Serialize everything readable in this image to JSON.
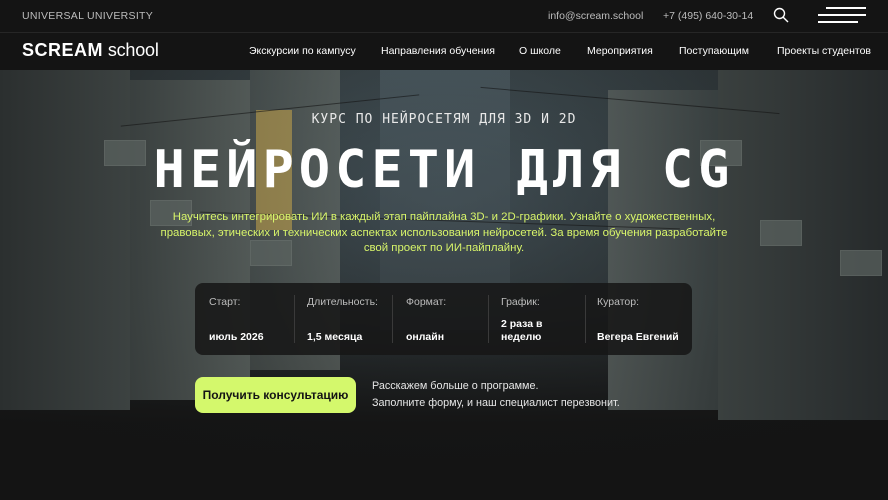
{
  "topbar": {
    "brand": "UNIVERSAL UNIVERSITY",
    "email": "info@scream.school",
    "phone": "+7 (495) 640-30-14"
  },
  "nav": {
    "logo_bold": "SCREAM",
    "logo_light": "school",
    "items": [
      {
        "label": "Экскурсии по кампусу"
      },
      {
        "label": "Направления обучения"
      },
      {
        "label": "О школе"
      },
      {
        "label": "Мероприятия"
      },
      {
        "label": "Поступающим"
      },
      {
        "label": "Проекты студентов"
      }
    ]
  },
  "hero": {
    "subtitle": "КУРС ПО НЕЙРОСЕТЯМ ДЛЯ 3D И 2D",
    "title": "НЕЙРОСЕТИ ДЛЯ CG",
    "description": "Научитесь интегрировать ИИ в каждый этап пайплайна 3D- и 2D-графики. Узнайте о художественных, правовых, этических и технических аспектах использования нейросетей. За время обучения разработайте свой проект по ИИ-пайплайну.",
    "info": [
      {
        "label": "Старт:",
        "value": "июль 2026"
      },
      {
        "label": "Длительность:",
        "value": "1,5 месяца"
      },
      {
        "label": "Формат:",
        "value": "онлайн"
      },
      {
        "label": "График:",
        "value": "2 раза в неделю"
      },
      {
        "label": "Куратор:",
        "value": "Вегера Евгений"
      }
    ],
    "cta_label": "Получить консультацию",
    "cta_note_line1": "Расскажем больше о программе.",
    "cta_note_line2": "Заполните форму, и наш специалист перезвонит."
  },
  "colors": {
    "accent": "#d4f86c",
    "background": "#141414",
    "description_text": "#d8f56a"
  },
  "icons": [
    "search-icon",
    "burger-menu-icon"
  ]
}
